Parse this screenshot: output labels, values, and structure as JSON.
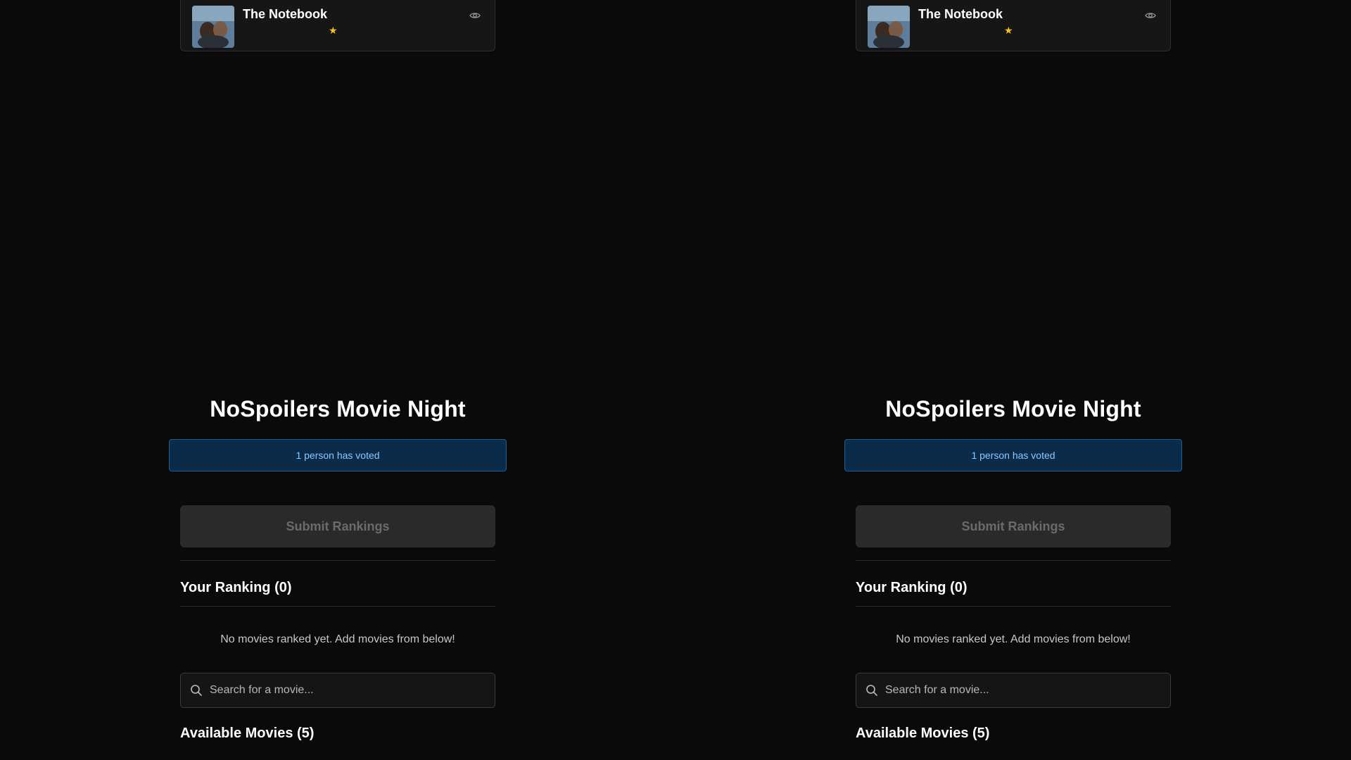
{
  "app": {
    "title": "NoSpoilers Movie Night"
  },
  "vote_status": {
    "text": "1 person has voted"
  },
  "actions": {
    "submit_label": "Submit Rankings"
  },
  "ranking": {
    "heading": "Your Ranking (0)",
    "empty_message": "No movies ranked yet. Add movies from below!"
  },
  "search": {
    "placeholder": "Search for a movie...",
    "value": ""
  },
  "available": {
    "heading": "Available Movies (5)",
    "movies": [
      {
        "title": "The Notebook",
        "icon": "eye-icon"
      }
    ]
  },
  "colors": {
    "background": "#0a0a0a",
    "banner_bg": "#0c2b48",
    "banner_text": "#8cc8ff",
    "button_disabled_bg": "#2a2a2a",
    "button_disabled_text": "#6b6b6b",
    "star": "#f5c518"
  }
}
